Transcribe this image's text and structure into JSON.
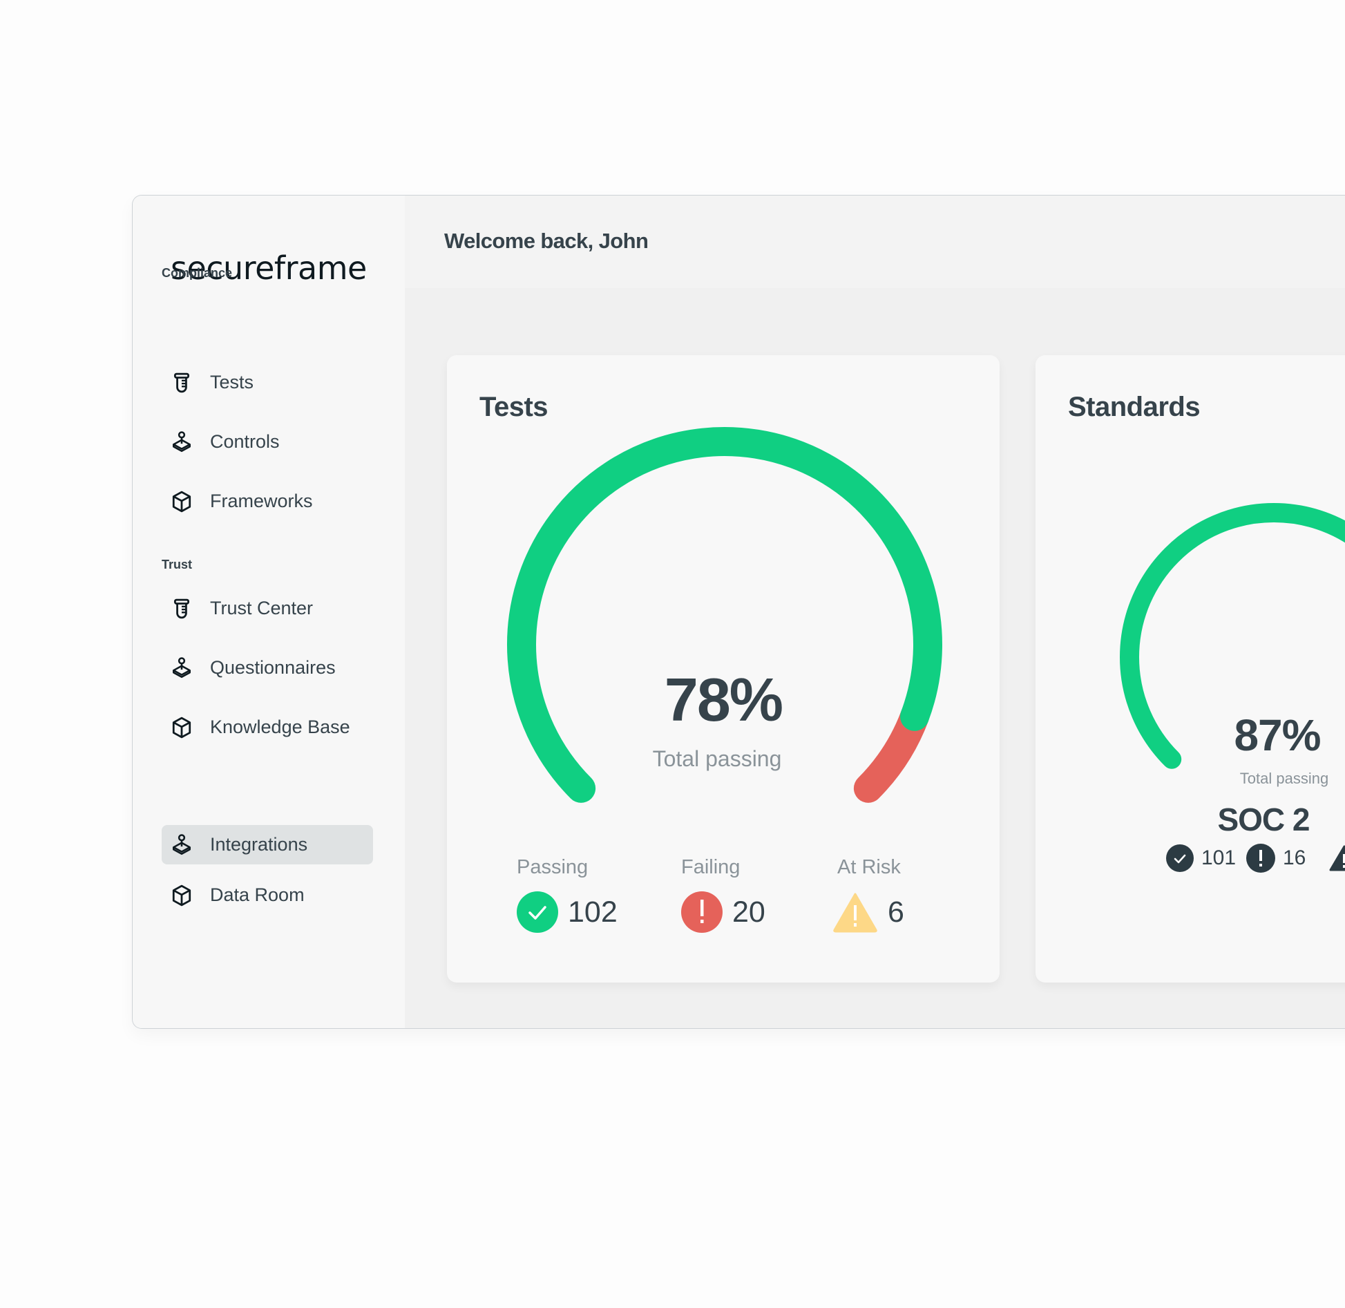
{
  "brand": {
    "logo_text": "secureframe"
  },
  "header": {
    "welcome": "Welcome back, John"
  },
  "sidebar": {
    "sections": [
      {
        "label": "Compliance",
        "items": [
          {
            "label": "Tests",
            "icon": "test-tube-icon"
          },
          {
            "label": "Controls",
            "icon": "joystick-icon"
          },
          {
            "label": "Frameworks",
            "icon": "cube-icon"
          }
        ]
      },
      {
        "label": "Trust",
        "items": [
          {
            "label": "Trust Center",
            "icon": "test-tube-icon"
          },
          {
            "label": "Questionnaires",
            "icon": "joystick-icon"
          },
          {
            "label": "Knowledge Base",
            "icon": "cube-icon"
          }
        ]
      },
      {
        "label": "",
        "items": [
          {
            "label": "Integrations",
            "icon": "joystick-icon",
            "active": true
          },
          {
            "label": "Data Room",
            "icon": "cube-icon"
          }
        ]
      }
    ]
  },
  "colors": {
    "passing": "#10cf82",
    "failing": "#e5625a",
    "at_risk": "#fdd887",
    "text": "#36434b",
    "muted": "#8a9399"
  },
  "tests_card": {
    "title": "Tests",
    "percent": "78%",
    "percent_caption": "Total passing",
    "stats": [
      {
        "label": "Passing",
        "value": "102",
        "icon": "check-circle-icon"
      },
      {
        "label": "Failing",
        "value": "20",
        "icon": "exclamation-circle-icon"
      },
      {
        "label": "At Risk",
        "value": "6",
        "icon": "warning-triangle-icon"
      }
    ]
  },
  "standards_card": {
    "title": "Standards",
    "percent": "87%",
    "percent_caption": "Total passing",
    "framework": "SOC 2",
    "stats": [
      {
        "value": "101",
        "icon": "check-circle-icon"
      },
      {
        "value": "16",
        "icon": "exclamation-circle-icon"
      },
      {
        "value": "",
        "icon": "warning-triangle-icon"
      }
    ]
  },
  "chart_data": [
    {
      "type": "gauge",
      "title": "Tests",
      "center_label": "78%",
      "caption": "Total passing",
      "segments": [
        {
          "name": "Passing",
          "fraction": 0.91,
          "color": "#10cf82"
        },
        {
          "name": "Failing",
          "fraction": 0.09,
          "color": "#e5625a"
        }
      ],
      "sweep_degrees": 270
    },
    {
      "type": "gauge",
      "title": "Standards",
      "center_label": "87%",
      "caption": "Total passing",
      "segments": [
        {
          "name": "Passing",
          "fraction": 1.0,
          "color": "#10cf82"
        }
      ],
      "sweep_degrees": 270
    }
  ]
}
